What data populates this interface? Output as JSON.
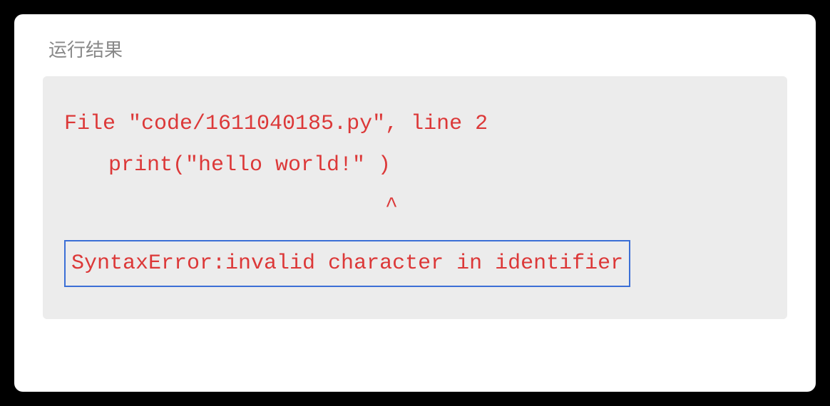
{
  "title": "运行结果",
  "output": {
    "line1": "File \"code/1611040185.py\", line 2",
    "line2": "print(\"hello world!\" )",
    "caret": "^",
    "error": "SyntaxError:invalid character in identifier"
  }
}
